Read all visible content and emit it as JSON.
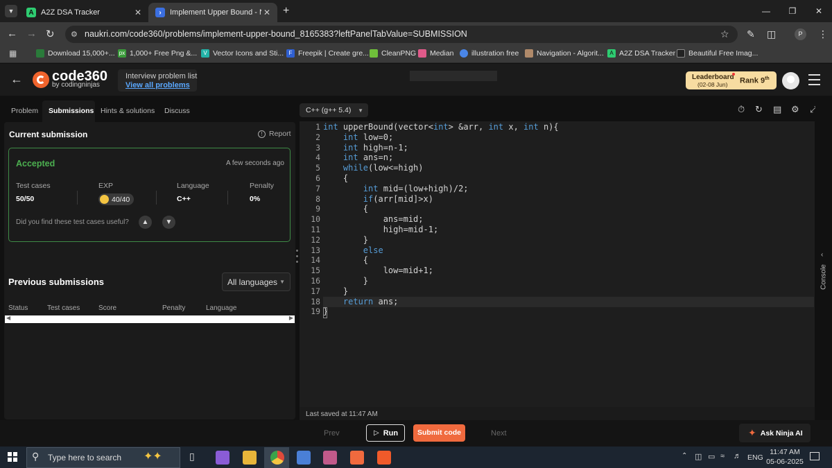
{
  "browser": {
    "tabs": [
      {
        "title": "A2Z DSA Tracker",
        "active": false
      },
      {
        "title": "Implement Upper Bound - Nau",
        "active": true
      }
    ],
    "url": "naukri.com/code360/problems/implement-upper-bound_8165383?leftPanelTabValue=SUBMISSION",
    "profile_initial": "P",
    "bookmarks": [
      "Download 15,000+...",
      "1,000+ Free Png &...",
      "Vector Icons and Sti...",
      "Freepik | Create gre...",
      "CleanPNG",
      "Median",
      "illustration free",
      "Navigation - Algorit...",
      "A2Z DSA Tracker",
      "Beautiful Free Imag..."
    ]
  },
  "header": {
    "logo_main": "code360",
    "logo_sub": "by codingninjas",
    "interview_label": "Interview problem list",
    "view_all": "View all problems",
    "leaderboard_label": "Leaderboard",
    "leaderboard_date": "(02-08 Jun)",
    "rank_label": "Rank",
    "rank_value": "9",
    "rank_suffix": "th"
  },
  "left_tabs": [
    "Problem",
    "Submissions",
    "Hints & solutions",
    "Discuss"
  ],
  "current_submission": {
    "title": "Current submission",
    "report": "Report",
    "status": "Accepted",
    "time": "A few seconds ago",
    "stats": {
      "test_cases_label": "Test cases",
      "test_cases_value": "50/50",
      "exp_label": "EXP",
      "exp_value": "40/40",
      "language_label": "Language",
      "language_value": "C++",
      "penalty_label": "Penalty",
      "penalty_value": "0%"
    },
    "feedback_question": "Did you find these test cases useful?"
  },
  "previous": {
    "title": "Previous submissions",
    "filter": "All languages",
    "columns": [
      "Status",
      "Test cases",
      "Score",
      "Penalty",
      "Language"
    ]
  },
  "editor": {
    "language": "C++ (g++ 5.4)",
    "last_saved": "Last saved at 11:47 AM",
    "console_label": "Console",
    "lines": [
      "int upperBound(vector<int> &arr, int x, int n){",
      "    int low=0;",
      "    int high=n-1;",
      "    int ans=n;",
      "    while(low<=high)",
      "    {",
      "        int mid=(low+high)/2;",
      "        if(arr[mid]>x)",
      "        {",
      "            ans=mid;",
      "            high=mid-1;",
      "        }",
      "        else",
      "        {",
      "            low=mid+1;",
      "        }",
      "    }",
      "    return ans;",
      "}"
    ]
  },
  "bottom": {
    "prev": "Prev",
    "run": "Run",
    "submit": "Submit code",
    "next": "Next",
    "ask": "Ask Ninja AI"
  },
  "taskbar": {
    "search_placeholder": "Type here to search",
    "time": "11:47 AM",
    "date": "05-06-2025",
    "lang": "ENG"
  },
  "colors": {
    "accent": "#f06a3e",
    "accepted": "#4caf50",
    "keyword": "#569cd6"
  }
}
